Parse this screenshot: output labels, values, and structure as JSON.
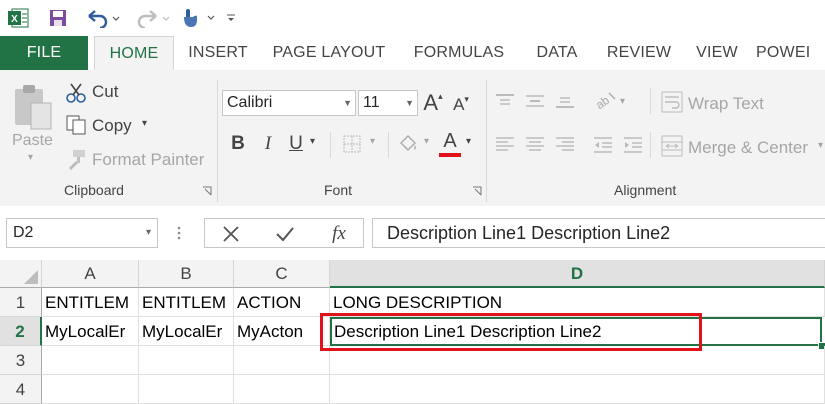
{
  "qat": {
    "icons": [
      "excel-logo-icon",
      "save-icon",
      "undo-icon",
      "redo-icon",
      "touch-mode-icon",
      "customize-qat-icon"
    ]
  },
  "tabs": [
    "FILE",
    "HOME",
    "INSERT",
    "PAGE LAYOUT",
    "FORMULAS",
    "DATA",
    "REVIEW",
    "VIEW",
    "POWEI"
  ],
  "ribbon": {
    "clipboard": {
      "paste": "Paste",
      "cut": "Cut",
      "copy": "Copy",
      "format_painter": "Format Painter",
      "label": "Clipboard"
    },
    "font": {
      "name": "Calibri",
      "size": "11",
      "bold": "B",
      "italic": "I",
      "underline": "U",
      "label": "Font",
      "font_color": "#e0131a"
    },
    "alignment": {
      "wrap_text": "Wrap Text",
      "merge_center": "Merge & Center",
      "label": "Alignment"
    }
  },
  "formula_bar": {
    "name_box": "D2",
    "fx": "fx",
    "content": "Description Line1 Description Line2"
  },
  "grid": {
    "columns": [
      "A",
      "B",
      "C",
      "D"
    ],
    "rows": [
      "1",
      "2",
      "3",
      "4"
    ],
    "cells": {
      "a1": "ENTITLEM",
      "b1": "ENTITLEM",
      "c1": "ACTION",
      "d1": "LONG DESCRIPTION",
      "a2": "MyLocalEr",
      "b2": "MyLocalEr",
      "c2": "MyActon",
      "d2": "Description Line1 Description Line2"
    },
    "active_cell": "D2"
  },
  "colors": {
    "accent": "#217346",
    "highlight": "#e0131a"
  }
}
